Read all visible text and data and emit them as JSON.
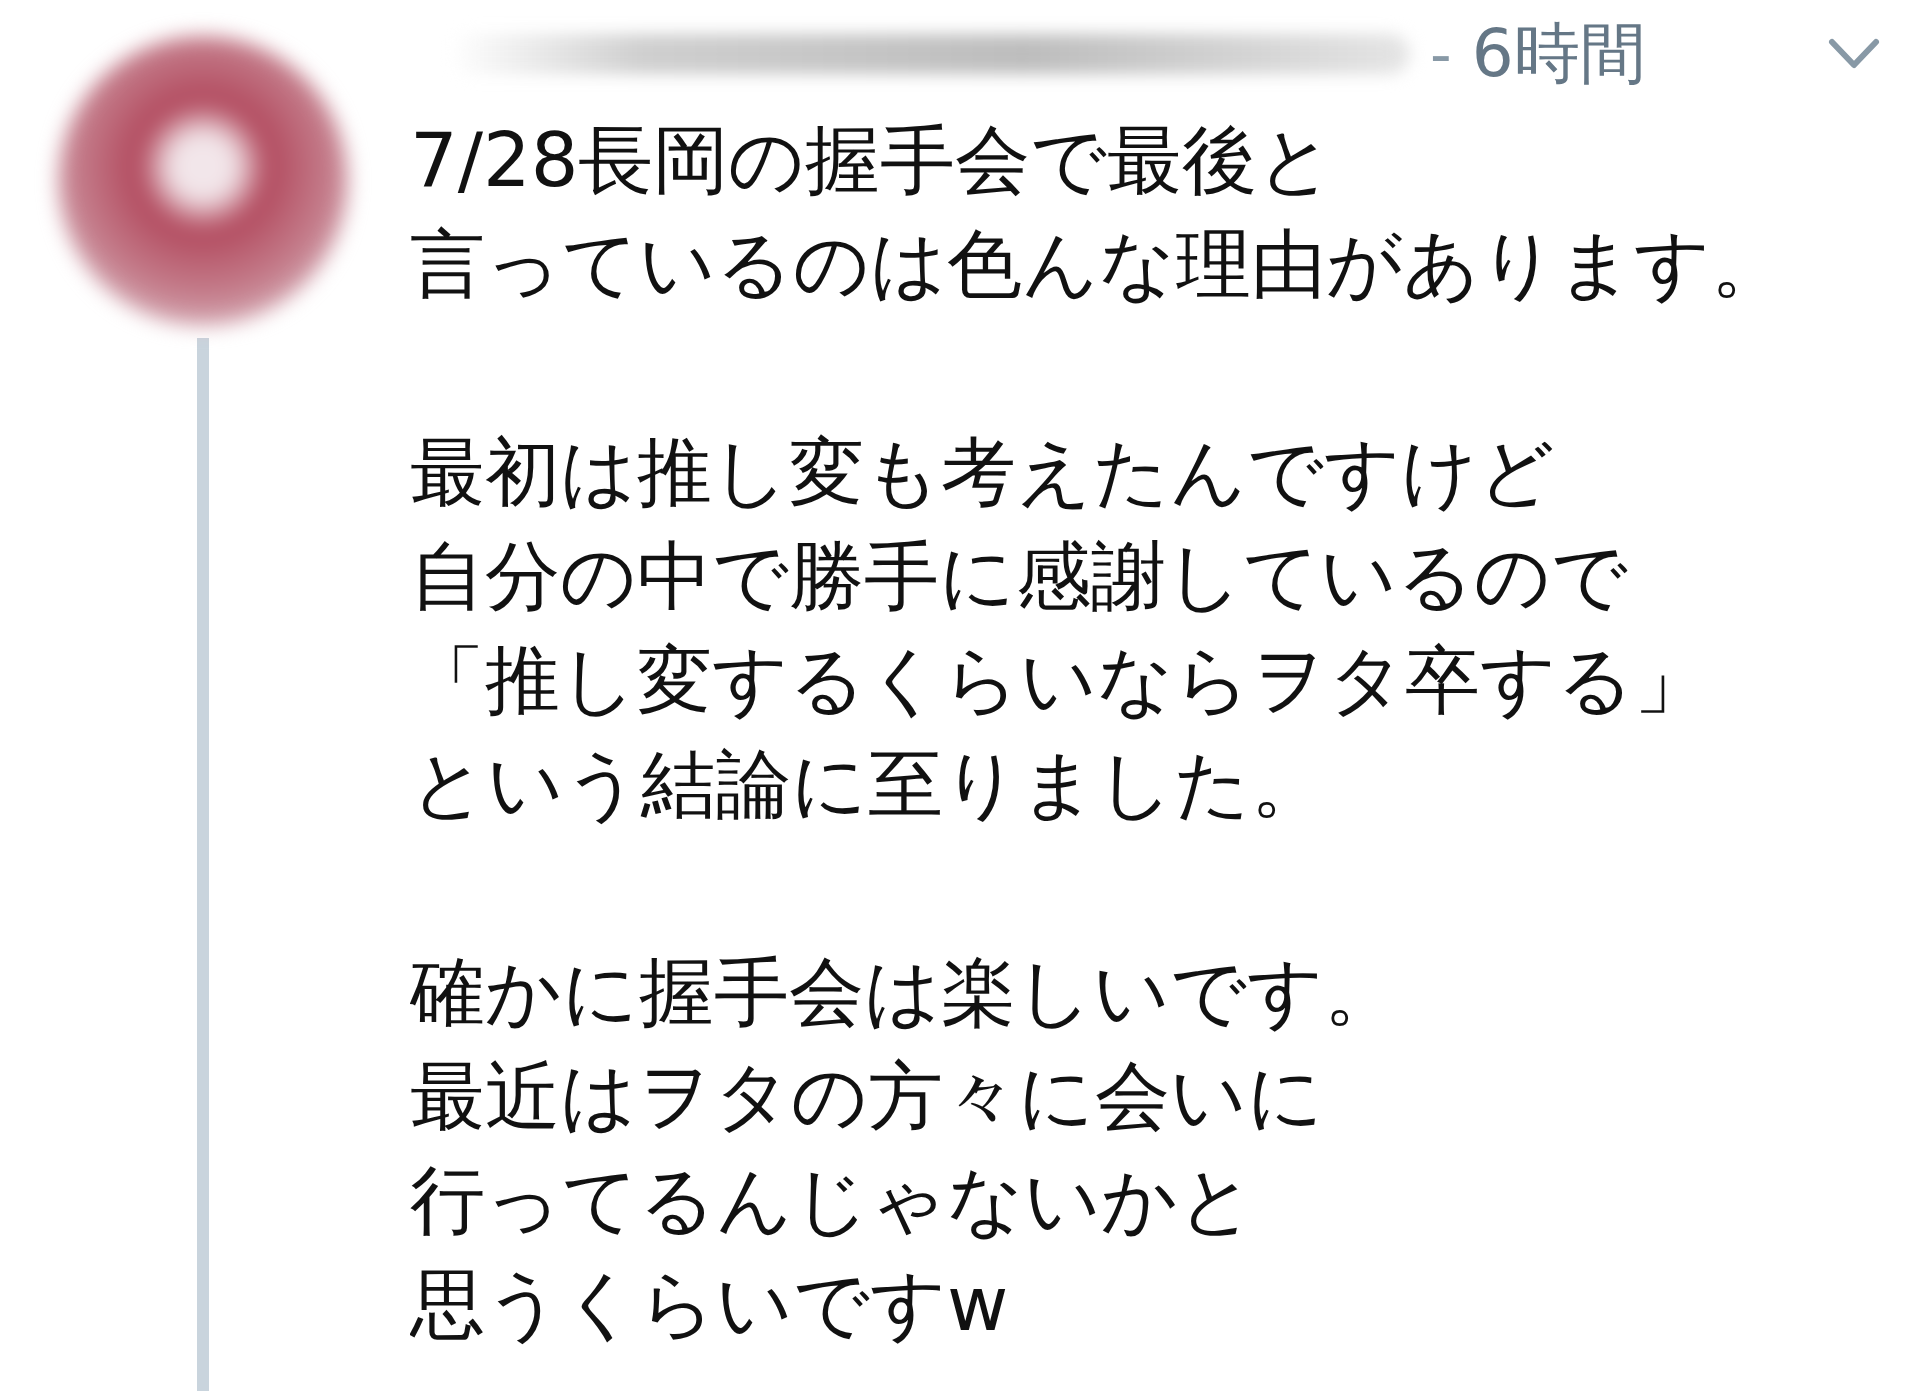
{
  "tweet": {
    "timestamp_separator": "-",
    "timestamp": "6時間",
    "paragraphs": [
      [
        "7/28長岡の握手会で最後と",
        "言っているのは色んな理由があります。"
      ],
      [
        "最初は推し変も考えたんですけど",
        "自分の中で勝手に感謝しているので",
        "「推し変するくらいならヲタ卒する」",
        "という結論に至りました。"
      ],
      [
        "確かに握手会は楽しいです。",
        "最近はヲタの方々に会いに",
        "行ってるんじゃないかと",
        "思うくらいですw"
      ]
    ]
  }
}
